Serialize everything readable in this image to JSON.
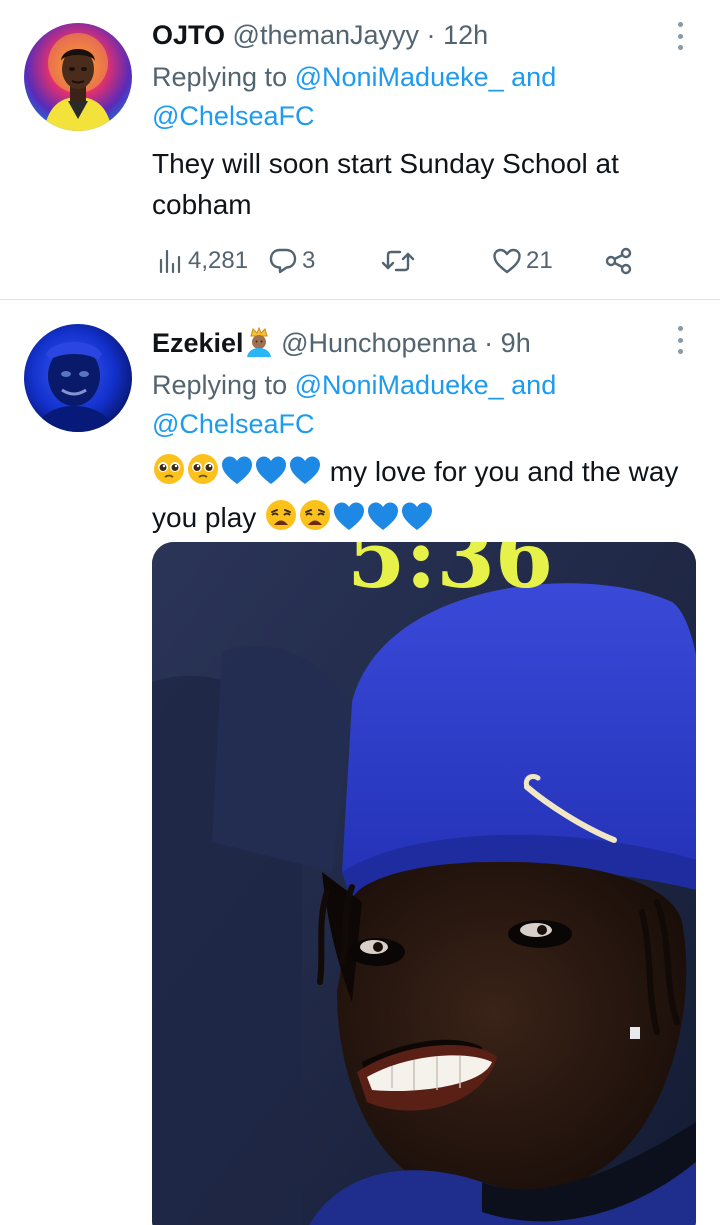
{
  "tweets": [
    {
      "name": "OJTO",
      "handle": "@themanJayyy",
      "separator": "·",
      "time": "12h",
      "replying_prefix": "Replying to",
      "replying_to_1": "@NoniMadueke_",
      "replying_and": "and",
      "replying_to_2": "@ChelseaFC",
      "text": "They will soon start Sunday School at cobham",
      "views": "4,281",
      "replies": "3",
      "likes": "21"
    },
    {
      "name": "Ezekiel",
      "handle": "@Hunchopenna",
      "separator": "·",
      "time": "9h",
      "replying_prefix": "Replying to",
      "replying_to_1": "@NoniMadueke_",
      "replying_and": "and",
      "replying_to_2": "@ChelseaFC",
      "text_main": "my love for you and the way you play",
      "media_overlay_text": "5:36"
    }
  ],
  "icons": {
    "views": "views-icon",
    "reply": "reply-icon",
    "retweet": "retweet-icon",
    "like": "like-icon",
    "share": "share-icon",
    "more": "more-icon",
    "crown_emoji": "crowned-person-emoji",
    "pleading_emoji": "pleading-face-emoji",
    "weary_emoji": "weary-face-emoji",
    "blue_heart_emoji": "blue-heart-emoji"
  },
  "colors": {
    "link": "#1d9bf0",
    "secondary_text": "#536471",
    "primary_text": "#0f1419",
    "divider": "#dfe3e6",
    "heart_blue": "#1e88e5"
  }
}
